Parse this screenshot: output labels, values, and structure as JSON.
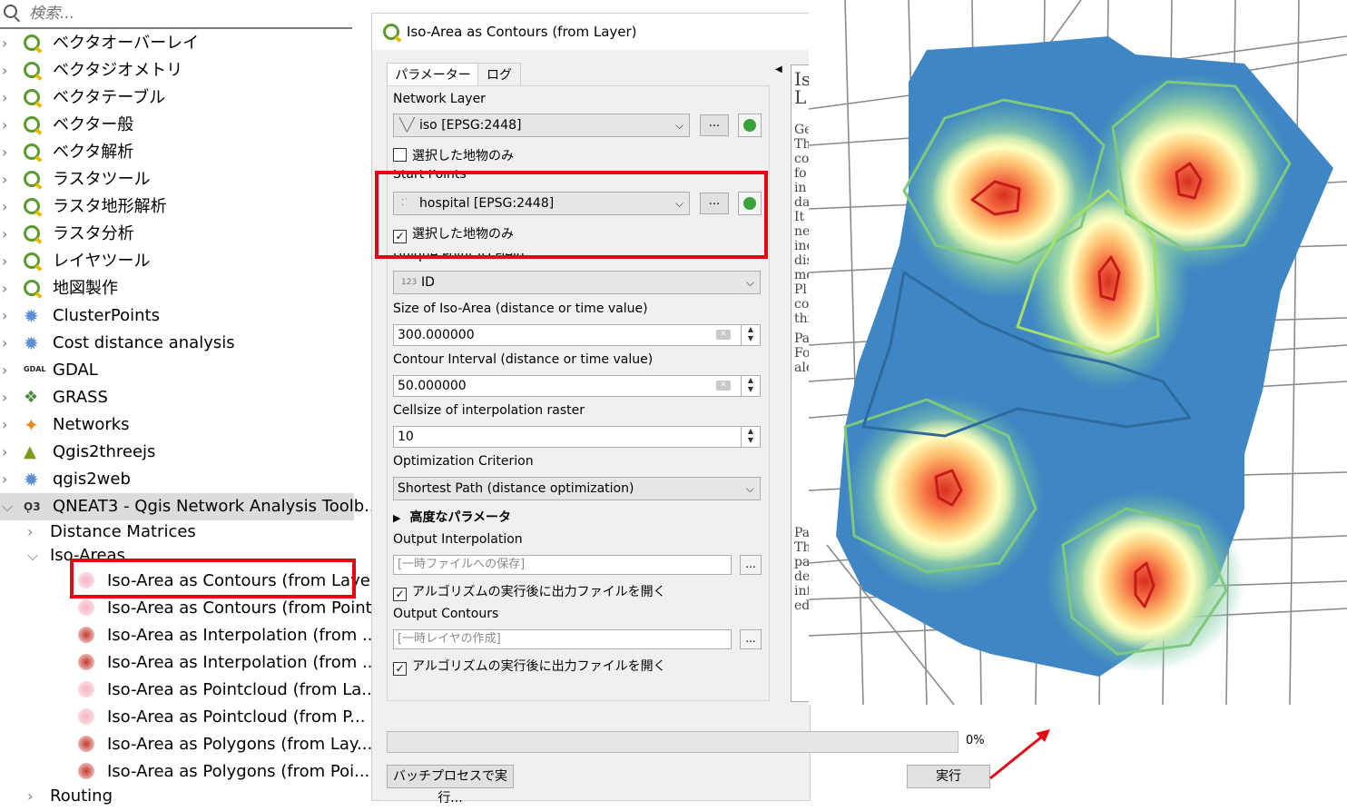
{
  "toolbox": {
    "search_placeholder": "検索...",
    "providers": [
      {
        "label": "ベクタオーバーレイ",
        "icon": "qgis-icon"
      },
      {
        "label": "ベクタジオメトリ",
        "icon": "qgis-icon"
      },
      {
        "label": "ベクタテーブル",
        "icon": "qgis-icon"
      },
      {
        "label": "ベクター般",
        "icon": "qgis-icon"
      },
      {
        "label": "ベクタ解析",
        "icon": "qgis-icon"
      },
      {
        "label": "ラスタツール",
        "icon": "qgis-icon"
      },
      {
        "label": "ラスタ地形解析",
        "icon": "qgis-icon"
      },
      {
        "label": "ラスタ分析",
        "icon": "qgis-icon"
      },
      {
        "label": "レイヤツール",
        "icon": "qgis-icon"
      },
      {
        "label": "地図製作",
        "icon": "qgis-icon"
      },
      {
        "label": "ClusterPoints",
        "icon": "gear-icon"
      },
      {
        "label": "Cost distance analysis",
        "icon": "gear-icon"
      },
      {
        "label": "GDAL",
        "icon": "gdal-icon"
      },
      {
        "label": "GRASS",
        "icon": "grass-icon"
      },
      {
        "label": "Networks",
        "icon": "networks-icon"
      },
      {
        "label": "Qgis2threejs",
        "icon": "triangle-icon"
      },
      {
        "label": "qgis2web",
        "icon": "gear-icon"
      },
      {
        "label": "QNEAT3 - Qgis Network Analysis Toolb...",
        "icon": "qneat3-icon"
      }
    ],
    "groups": {
      "distance_matrices": "Distance Matrices",
      "iso_areas": "Iso-Areas",
      "routing": "Routing"
    },
    "algorithms": [
      "Iso-Area as Contours (from Layer)",
      "Iso-Area as Contours (from Point)",
      "Iso-Area as Interpolation (from ...",
      "Iso-Area as Interpolation (from ...",
      "Iso-Area as Pointcloud (from La...",
      "Iso-Area as Pointcloud (from P...",
      "Iso-Area as Polygons (from Lay...",
      "Iso-Area as Polygons (from Poi..."
    ]
  },
  "dialog": {
    "title": "Iso-Area as Contours (from Layer)",
    "tabs": [
      "パラメーター",
      "ログ"
    ],
    "network_layer_label": "Network Layer",
    "network_layer_value": "iso [EPSG:2448]",
    "selected_only_label": "選択した地物のみ",
    "start_points_label": "Start Points",
    "start_points_value": "hospital [EPSG:2448]",
    "start_selected_only_label": "選択した地物のみ",
    "unique_id_label": "Unique Point ID Field",
    "unique_id_prefix": "123",
    "unique_id_value": "ID",
    "size_label": "Size of Iso-Area (distance or time value)",
    "size_value": "300.000000",
    "interval_label": "Contour Interval (distance or time value)",
    "interval_value": "50.000000",
    "cellsize_label": "Cellsize of interpolation raster",
    "cellsize_value": "10",
    "optimization_label": "Optimization Criterion",
    "optimization_value": "Shortest Path (distance optimization)",
    "advanced_label": "高度なパラメータ",
    "output_interp_label": "Output Interpolation",
    "output_interp_placeholder": "[一時ファイルへの保存]",
    "open_after_label_1": "アルゴリズムの実行後に出力ファイルを開く",
    "output_contours_label": "Output Contours",
    "output_contours_placeholder": "[一時レイヤの作成]",
    "open_after_label_2": "アルゴリズムの実行後に出力ファイルを開く",
    "dots": "...",
    "progress_percent": 0,
    "progress_text": "0%",
    "batch_button": "バッチプロセスで実行...",
    "run_button": "実行",
    "help_fragments": [
      "Is",
      "L",
      "Ge",
      "Th",
      "co",
      "fo",
      "in",
      "da",
      "It",
      "ne",
      "inc",
      "dis",
      "me",
      "Pl",
      "co",
      "thi",
      "Pa",
      "Fo",
      "ale",
      "Pa",
      "Th",
      "pa",
      "de",
      "inf",
      "ed"
    ]
  },
  "colors": {
    "highlight_red": "#e30613",
    "map_blue": "#3f86c4",
    "qgis_green": "#5a9a2e"
  }
}
